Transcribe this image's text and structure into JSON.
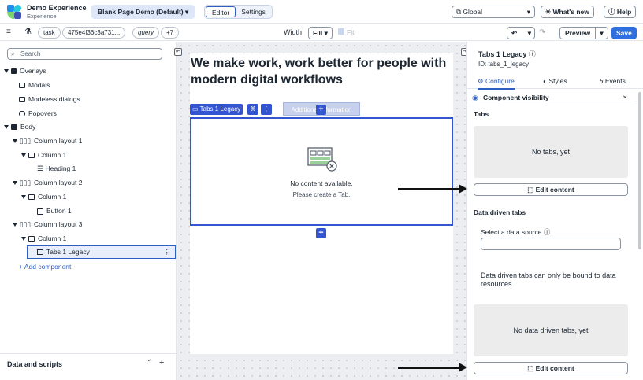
{
  "header": {
    "app_title": "Demo Experience",
    "app_subtitle": "Experience",
    "page_selector": "Blank Page Demo (Default)",
    "mode_editor": "Editor",
    "mode_settings": "Settings",
    "scope_select": "Global",
    "whats_new": "What's new",
    "help": "Help"
  },
  "toolbar": {
    "chip_task": "task",
    "chip_id": "475e4f36c3a731...",
    "chip_query": "query",
    "chip_more": "+7",
    "width_label": "Width",
    "width_value": "Fill",
    "fit_label": "Fit",
    "preview": "Preview",
    "save": "Save"
  },
  "left": {
    "search_placeholder": "Search",
    "items": [
      {
        "label": "Overlays"
      },
      {
        "label": "Modals"
      },
      {
        "label": "Modeless dialogs"
      },
      {
        "label": "Popovers"
      },
      {
        "label": "Body"
      },
      {
        "label": "Column layout 1"
      },
      {
        "label": "Column 1"
      },
      {
        "label": "Heading 1"
      },
      {
        "label": "Column layout 2"
      },
      {
        "label": "Column 1"
      },
      {
        "label": "Button 1"
      },
      {
        "label": "Column layout 3"
      },
      {
        "label": "Column 1"
      },
      {
        "label": "Tabs 1 Legacy"
      }
    ],
    "add_component": "Add component",
    "data_and_scripts": "Data and scripts"
  },
  "canvas": {
    "heading": "We make work, work better for people with modern digital workflows",
    "tab_chip": "Tabs 1 Legacy",
    "additional_information": "Additional information",
    "no_content": "No content available.",
    "please_create": "Please create a Tab."
  },
  "right": {
    "title": "Tabs 1 Legacy",
    "id_label": "ID: tabs_1_legacy",
    "tab_configure": "Configure",
    "tab_styles": "Styles",
    "tab_events": "Events",
    "component_visibility": "Component visibility",
    "tabs_section": "Tabs",
    "no_tabs": "No tabs, yet",
    "edit_content": "Edit content",
    "data_driven_tabs": "Data driven tabs",
    "select_data_source": "Select a data source",
    "data_driven_note": "Data driven tabs can only be bound to data resources",
    "no_data_driven_tabs": "No data driven tabs, yet",
    "edit_content_2": "Edit content"
  },
  "colors": {
    "accent": "#3455d1",
    "save_button": "#2f6fe0"
  }
}
